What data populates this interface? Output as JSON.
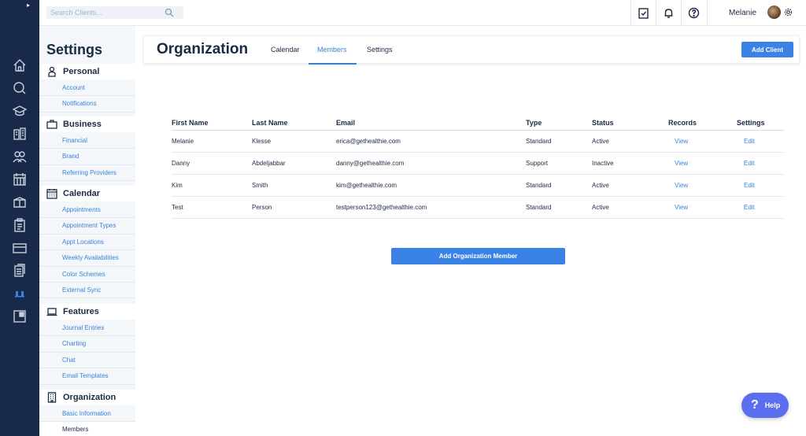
{
  "search": {
    "placeholder": "Search Clients..."
  },
  "user": {
    "name": "Melanie"
  },
  "settings": {
    "title": "Settings",
    "groups": [
      {
        "label": "Personal",
        "icon": "person-icon",
        "items": [
          "Account",
          "Notifications"
        ]
      },
      {
        "label": "Business",
        "icon": "briefcase-icon",
        "items": [
          "Financial",
          "Brand",
          "Referring Providers"
        ]
      },
      {
        "label": "Calendar",
        "icon": "calendar-icon",
        "items": [
          "Appointments",
          "Appointment Types",
          "Appt Locations",
          "Weekly Availabilities",
          "Color Schemes",
          "External Sync"
        ]
      },
      {
        "label": "Features",
        "icon": "laptop-icon",
        "items": [
          "Journal Entries",
          "Charting",
          "Chat",
          "Email Templates"
        ]
      },
      {
        "label": "Organization",
        "icon": "building-icon",
        "items": [
          "Basic Information",
          "Members"
        ]
      }
    ]
  },
  "header": {
    "title": "Organization",
    "tabs": [
      "Calendar",
      "Members",
      "Settings"
    ],
    "active_tab": "Members",
    "add_client": "Add Client"
  },
  "table": {
    "columns": [
      "First Name",
      "Last Name",
      "Email",
      "Type",
      "Status",
      "Records",
      "Settings"
    ],
    "rows": [
      {
        "first": "Melanie",
        "last": "Klesse",
        "email": "erica@gethealthie.com",
        "type": "Standard",
        "status": "Active",
        "records": "View",
        "settings": "Edit"
      },
      {
        "first": "Danny",
        "last": "Abdeljabbar",
        "email": "danny@gethealthie.com",
        "type": "Support",
        "status": "Inactive",
        "records": "View",
        "settings": "Edit"
      },
      {
        "first": "Kim",
        "last": "Smith",
        "email": "kim@gethealthie.com",
        "type": "Standard",
        "status": "Active",
        "records": "View",
        "settings": "Edit"
      },
      {
        "first": "Test",
        "last": "Person",
        "email": "testperson123@gethealthie.com",
        "type": "Standard",
        "status": "Active",
        "records": "View",
        "settings": "Edit"
      }
    ]
  },
  "add_member": "Add Organization Member",
  "help": {
    "label": "Help",
    "glyph": "?"
  },
  "colors": {
    "rail": "#18294a",
    "accent": "#3b82e6",
    "help": "#5b6ef0"
  }
}
